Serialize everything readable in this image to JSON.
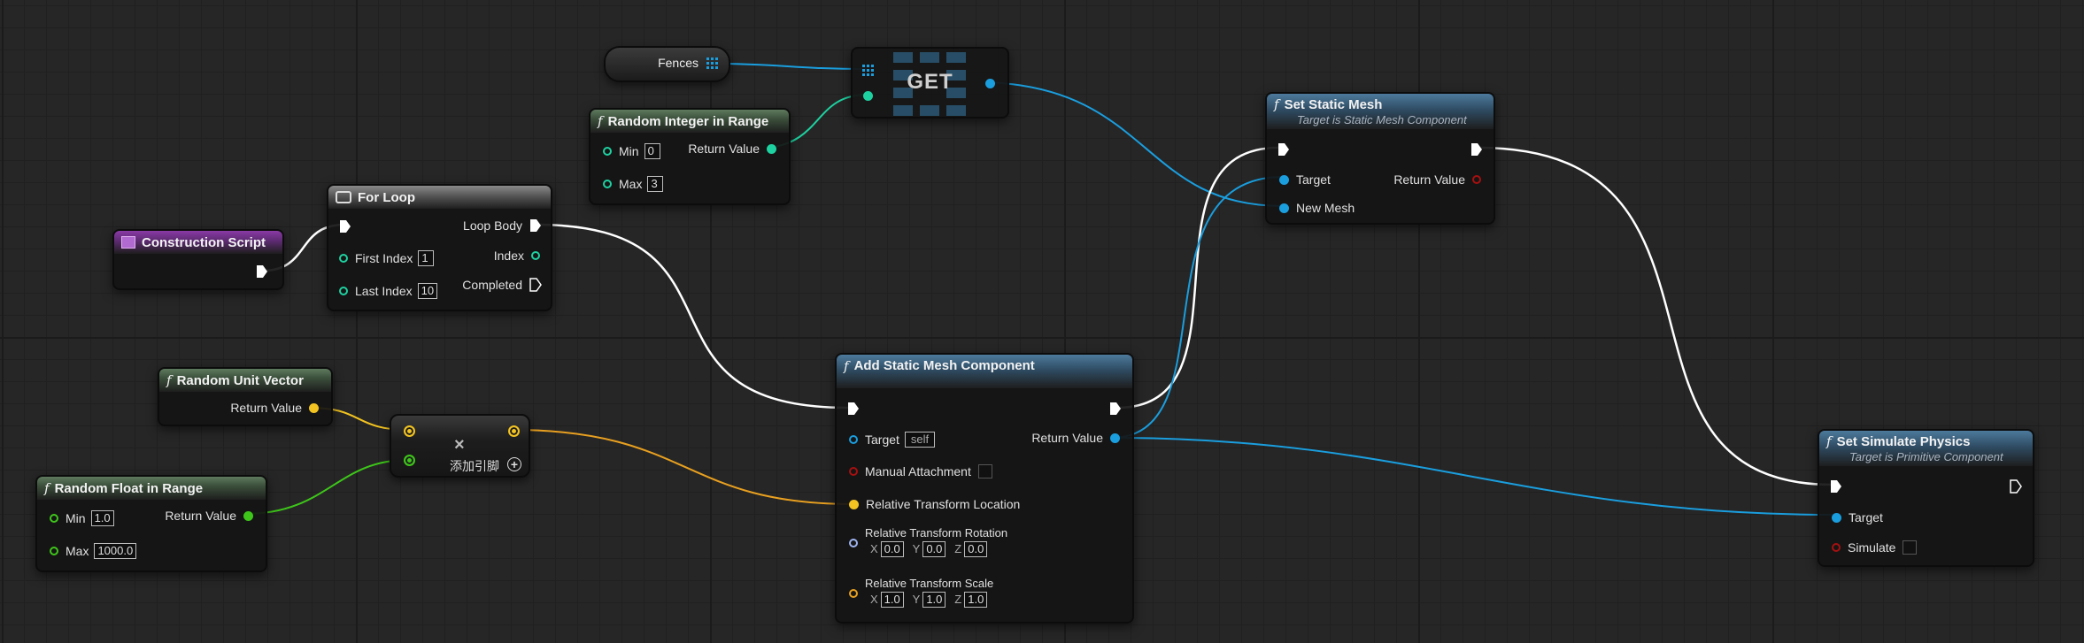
{
  "colors": {
    "exec": "#ffffff",
    "integer": "#1ed1a0",
    "float": "#3ec61a",
    "vector": "#f2c321",
    "object": "#1a9ede",
    "boolean": "#a61010",
    "rotator": "#9fb4f0",
    "transform": "#e8a020"
  },
  "nodes": {
    "fences": {
      "label": "Fences",
      "icon": "array-grid-icon"
    },
    "get": {
      "label": "GET"
    },
    "random_integer": {
      "title": "Random Integer in Range",
      "min_label": "Min",
      "min_value": "0",
      "max_label": "Max",
      "max_value": "3",
      "return_label": "Return Value"
    },
    "construction_script": {
      "title": "Construction Script"
    },
    "for_loop": {
      "title": "For Loop",
      "loop_body": "Loop Body",
      "first_index_label": "First Index",
      "first_index_value": "1",
      "index": "Index",
      "last_index_label": "Last Index",
      "last_index_value": "10",
      "completed": "Completed"
    },
    "random_unit_vector": {
      "title": "Random Unit Vector",
      "return_label": "Return Value"
    },
    "multiply": {
      "add_pin": "添加引脚"
    },
    "random_float": {
      "title": "Random Float in Range",
      "min_label": "Min",
      "min_value": "1.0",
      "max_label": "Max",
      "max_value": "1000.0",
      "return_label": "Return Value"
    },
    "add_static_mesh": {
      "title": "Add Static Mesh Component",
      "target_label": "Target",
      "target_value": "self",
      "return_label": "Return Value",
      "manual_attachment": "Manual Attachment",
      "location": "Relative Transform Location",
      "rotation": "Relative Transform Rotation",
      "rot_x": "0.0",
      "rot_y": "0.0",
      "rot_z": "0.0",
      "scale": "Relative Transform Scale",
      "scale_x": "1.0",
      "scale_y": "1.0",
      "scale_z": "1.0",
      "axis_x": "X",
      "axis_y": "Y",
      "axis_z": "Z"
    },
    "set_static_mesh": {
      "title": "Set Static Mesh",
      "subtitle": "Target is Static Mesh Component",
      "target_label": "Target",
      "return_label": "Return Value",
      "new_mesh_label": "New Mesh"
    },
    "set_simulate_physics": {
      "title": "Set Simulate Physics",
      "subtitle": "Target is Primitive Component",
      "target_label": "Target",
      "simulate_label": "Simulate"
    }
  }
}
